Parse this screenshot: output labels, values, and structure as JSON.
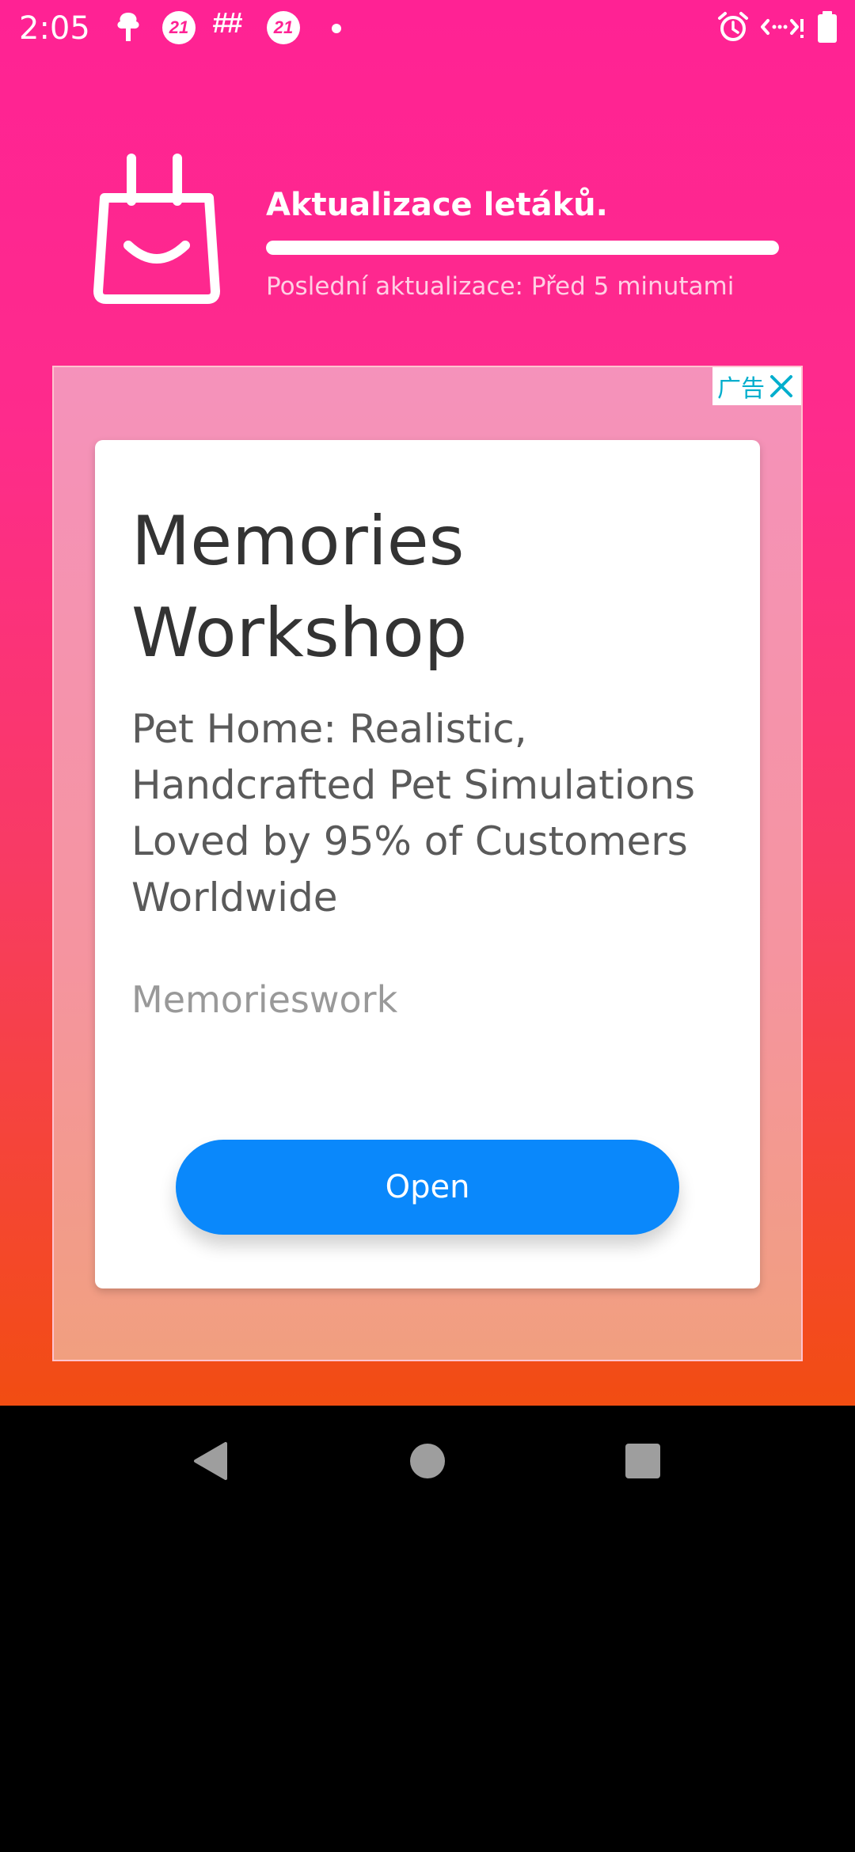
{
  "status_bar": {
    "time": "2:05",
    "badge_1": "21",
    "badge_2": "21",
    "tally": "##",
    "icons": [
      "tree-icon",
      "badge-21-icon",
      "tally-icon",
      "badge-21-icon",
      "dot-icon",
      "alarm-icon",
      "data-saver-icon",
      "battery-icon"
    ]
  },
  "header": {
    "icon": "shopping-bag-smile-icon",
    "title": "Aktualizace letáků.",
    "progress": 1.0,
    "subtitle": "Poslední aktualizace: Před 5 minutami"
  },
  "ad": {
    "choice_label": "广告",
    "headline": "Memories Workshop",
    "body": "Pet Home: Realistic, Handcrafted Pet Simulations Loved by 95% of Customers Worldwide",
    "advertiser": "Memorieswork",
    "cta": "Open",
    "colors": {
      "cta": "#0a88fb",
      "choice_text": "#00aecd"
    }
  },
  "nav_bar": {
    "icons": [
      "back-icon",
      "home-icon",
      "recents-icon"
    ]
  },
  "colors": {
    "gradient_top": "#ff2294",
    "gradient_bottom": "#f24d12"
  }
}
